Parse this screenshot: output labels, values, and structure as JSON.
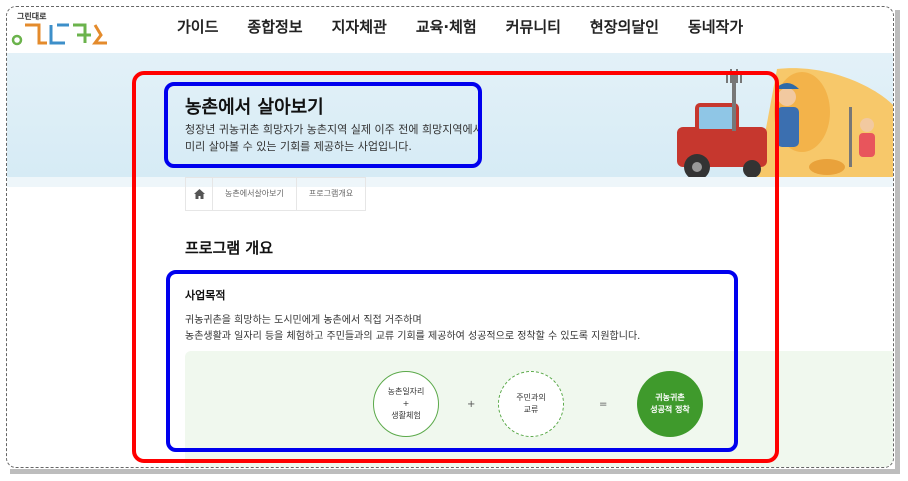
{
  "header": {
    "logo_small": "그린대로",
    "nav": [
      "가이드",
      "종합정보",
      "지자체관",
      "교육·체험",
      "커뮤니티",
      "현장의달인",
      "동네작가"
    ]
  },
  "hero": {
    "title": "농촌에서 살아보기",
    "desc_line1": "청장년 귀농귀촌 희망자가 농촌지역 실제 이주 전에 희망지역에서",
    "desc_line2": "미리 살아볼 수 있는 기회를 제공하는 사업입니다."
  },
  "breadcrumb": {
    "home_icon": "home-icon",
    "items": [
      "농촌에서살아보기",
      "프로그램개요"
    ]
  },
  "content": {
    "section_title": "프로그램 개요",
    "purpose_title": "사업목적",
    "purpose_line1": "귀농귀촌을 희망하는 도시민에게 농촌에서 직접 거주하며",
    "purpose_line2": "농촌생활과 일자리 등을 체험하고 주민들과의 교류 기회를 제공하여 성공적으로 정착할 수 있도록 지원합니다."
  },
  "diagram": {
    "c1_l1": "농촌일자리",
    "c1_l2": "+",
    "c1_l3": "생활체험",
    "op1": "+",
    "c2_l1": "주민과의",
    "c2_l2": "교류",
    "op2": "=",
    "c3_l1": "귀농귀촌",
    "c3_l2": "성공적 정착"
  },
  "colors": {
    "annotation_red": "#ff0000",
    "annotation_blue": "#0000ee",
    "accent_green": "#3f9a2c",
    "hero_bg": "#d6ebf5"
  }
}
